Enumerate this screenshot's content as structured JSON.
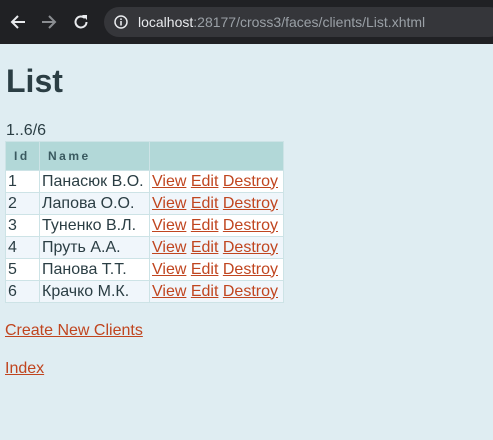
{
  "browser": {
    "url_host": "localhost",
    "url_rest": ":28177/cross3/faces/clients/List.xhtml"
  },
  "page": {
    "title": "List",
    "pager": "1..6/6"
  },
  "table": {
    "headers": {
      "id": "Id",
      "name": "Name",
      "actions": ""
    },
    "rows": [
      {
        "id": "1",
        "name": "Панасюк В.О.",
        "view": "View",
        "edit": "Edit",
        "destroy": "Destroy"
      },
      {
        "id": "2",
        "name": "Лапова О.О.",
        "view": "View",
        "edit": "Edit",
        "destroy": "Destroy"
      },
      {
        "id": "3",
        "name": "Туненко В.Л.",
        "view": "View",
        "edit": "Edit",
        "destroy": "Destroy"
      },
      {
        "id": "4",
        "name": "Пруть А.А.",
        "view": "View",
        "edit": "Edit",
        "destroy": "Destroy"
      },
      {
        "id": "5",
        "name": "Панова Т.Т.",
        "view": "View",
        "edit": "Edit",
        "destroy": "Destroy"
      },
      {
        "id": "6",
        "name": "Крачко М.К.",
        "view": "View",
        "edit": "Edit",
        "destroy": "Destroy"
      }
    ]
  },
  "links": {
    "create": "Create New Clients",
    "index": "Index"
  },
  "colors": {
    "page_bg": "#dfedf2",
    "header_bg": "#b2d8d8",
    "link": "#c0451f"
  }
}
